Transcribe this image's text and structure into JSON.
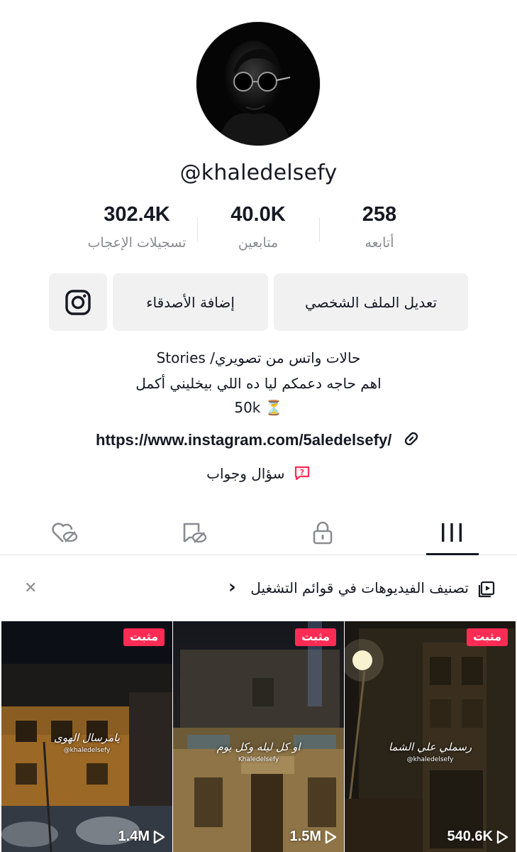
{
  "profile": {
    "username": "@khaledelsefy",
    "stats": [
      {
        "value": "302.4K",
        "label": "تسجيلات الإعجاب"
      },
      {
        "value": "40.0K",
        "label": "متابعين"
      },
      {
        "value": "258",
        "label": "أتابعه"
      }
    ],
    "buttons": {
      "edit_profile": "تعديل الملف الشخصي",
      "add_friends": "إضافة الأصدقاء",
      "instagram_icon": "instagram-icon"
    },
    "bio": {
      "line1": "حالات واتس من تصويري/ Stories",
      "line2": "اهم حاجه دعمكم ليا ده اللي بيخليني أكمل",
      "line3": "50k ⏳"
    },
    "link": "https://www.instagram.com/5aledelsefy/",
    "qa": "سؤال وجواب"
  },
  "tabs": [
    {
      "name": "videos",
      "icon": "grid-lines-icon",
      "active": true
    },
    {
      "name": "private",
      "icon": "lock-icon",
      "active": false
    },
    {
      "name": "reposts",
      "icon": "repost-hidden-icon",
      "active": false
    },
    {
      "name": "liked",
      "icon": "liked-hidden-icon",
      "active": false
    }
  ],
  "playlist_banner": {
    "text": "تصنيف الفيديوهات في قوائم التشغيل",
    "chevron": "›"
  },
  "videos": [
    {
      "pinned_label": "مثبت",
      "views": "540.6K",
      "caption": "رسملي علي الشما",
      "caption_sub": "@khaledelsefy"
    },
    {
      "pinned_label": "مثبت",
      "views": "1.5M",
      "caption": "او كل ليله وكل يوم",
      "caption_sub": "Khaledelsefy"
    },
    {
      "pinned_label": "مثبت",
      "views": "1.4M",
      "caption": "يامرسال الهوى",
      "caption_sub": "@khaledelsefy"
    }
  ],
  "colors": {
    "accent": "#fe2c55",
    "text": "#161823",
    "muted": "#8a8b91",
    "button_bg": "#f1f1f2"
  }
}
